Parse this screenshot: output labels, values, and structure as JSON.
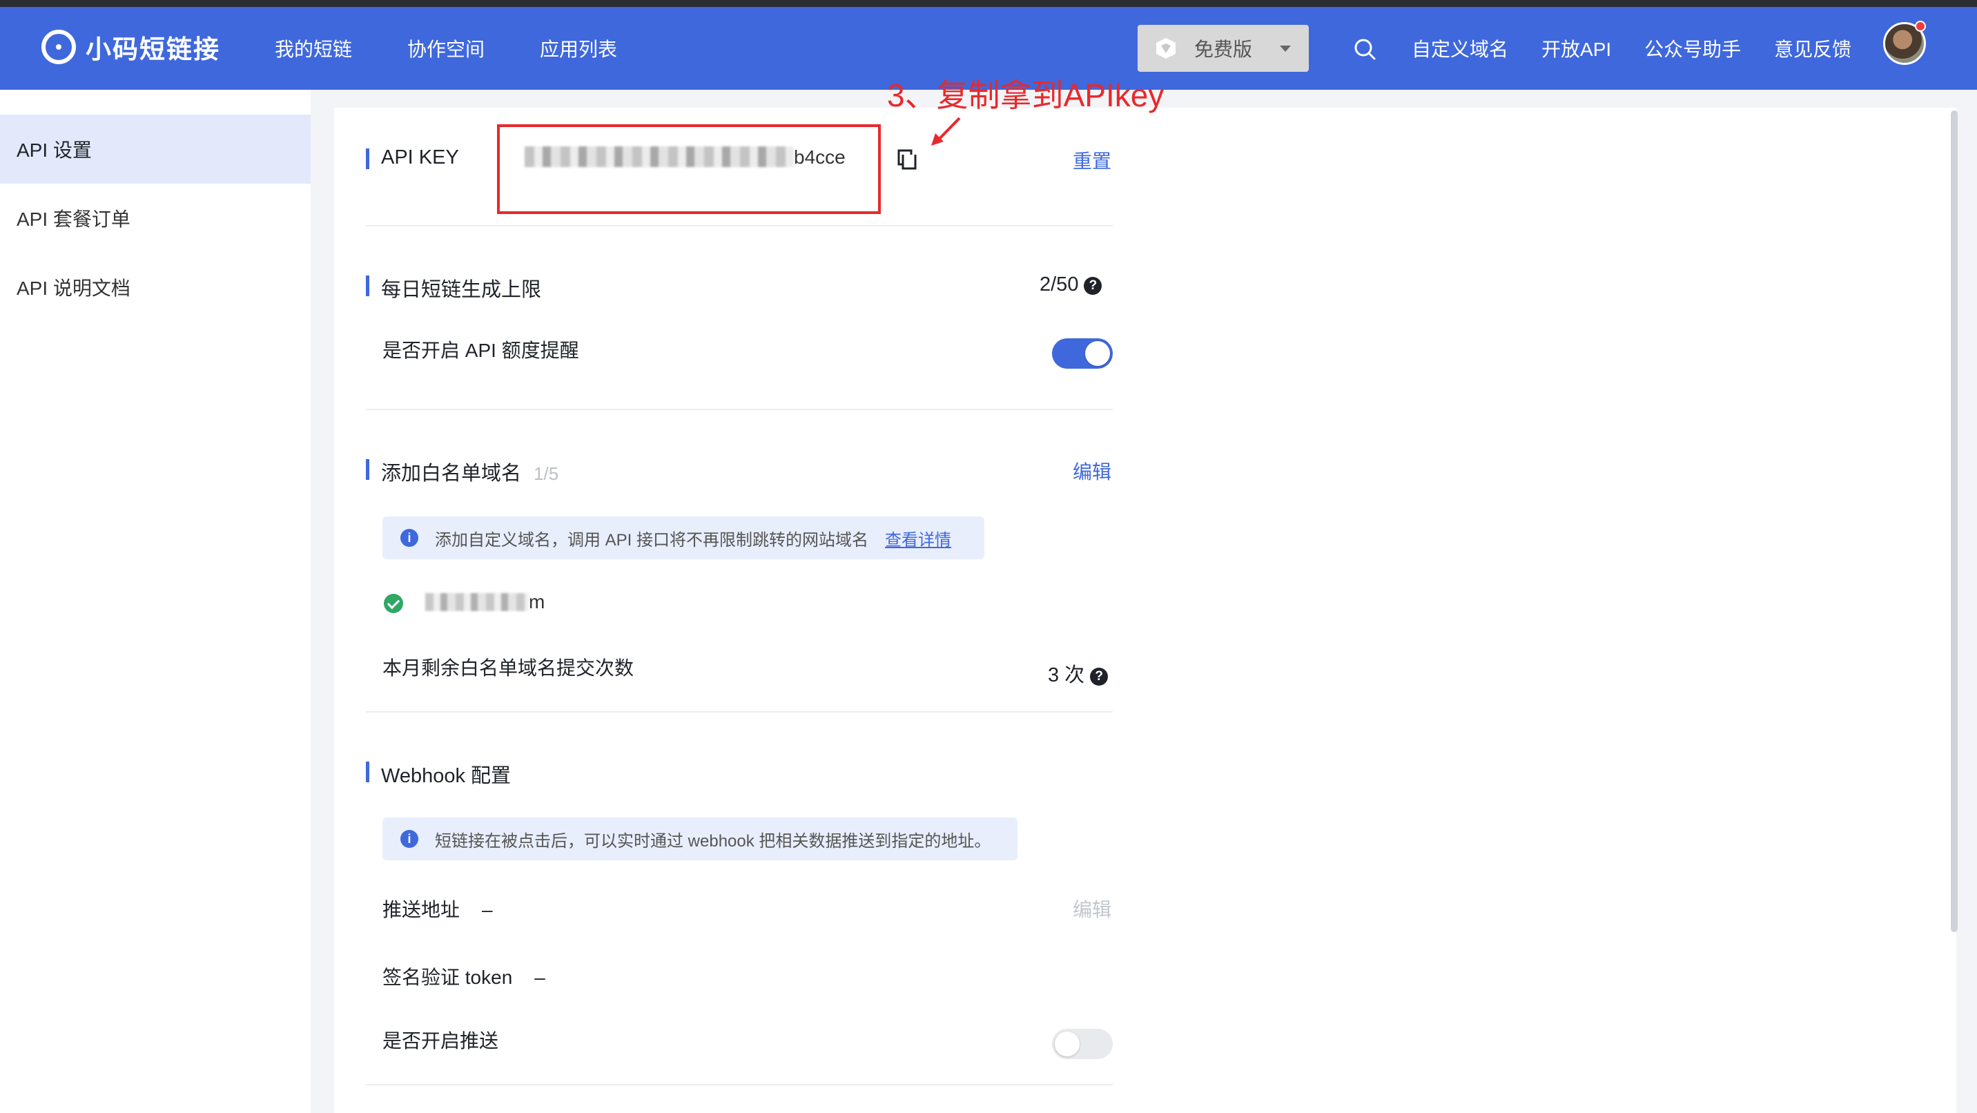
{
  "app": {
    "name": "小码短链接",
    "nav": [
      "我的短链",
      "协作空间",
      "应用列表"
    ],
    "plan_label": "免费版",
    "right_links": [
      "自定义域名",
      "开放API",
      "公众号助手",
      "意见反馈"
    ]
  },
  "sidebar": {
    "items": [
      {
        "label": "API 设置"
      },
      {
        "label": "API 套餐订单"
      },
      {
        "label": "API 说明文档"
      }
    ]
  },
  "api_key_section": {
    "label": "API KEY",
    "key_suffix": "b4cce",
    "reset_label": "重置"
  },
  "annotation": {
    "text": "3、复制拿到APIkey",
    "color": "#e8292c"
  },
  "daily_limit": {
    "title": "每日短链生成上限",
    "value": "2/50",
    "alert_label": "是否开启 API 额度提醒",
    "alert_enabled": true
  },
  "whitelist": {
    "title": "添加白名单域名",
    "count": "1/5",
    "edit_label": "编辑",
    "info_text": "添加自定义域名，调用 API 接口将不再限制跳转的网站域名",
    "info_link": "查看详情",
    "domain_suffix": "m",
    "remaining_label": "本月剩余白名单域名提交次数",
    "remaining_value": "3 次"
  },
  "webhook": {
    "title": "Webhook 配置",
    "info_text": "短链接在被点击后，可以实时通过 webhook 把相关数据推送到指定的地址。",
    "push_url_label": "推送地址",
    "push_url_value": "–",
    "edit_label": "编辑",
    "token_label": "签名验证 token",
    "token_value": "–",
    "push_enabled_label": "是否开启推送",
    "push_enabled": false
  },
  "colors": {
    "brand": "#3f68dc",
    "annotation": "#e8292c",
    "success": "#2fa866"
  }
}
